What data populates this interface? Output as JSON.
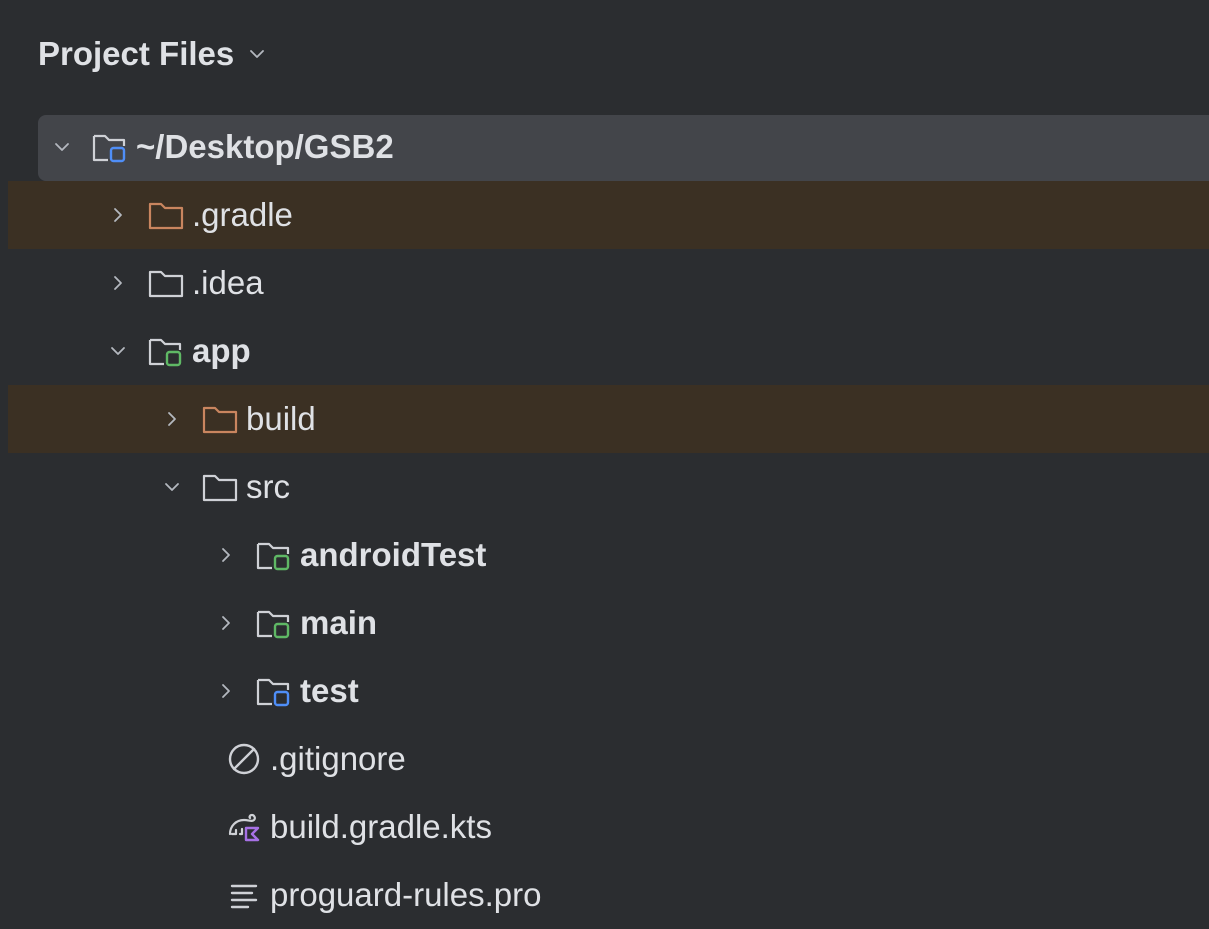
{
  "panel": {
    "title": "Project Files"
  },
  "tree": {
    "root": "~/Desktop/GSB2",
    "gradle": ".gradle",
    "idea": ".idea",
    "app": "app",
    "build": "build",
    "src": "src",
    "androidTest": "androidTest",
    "main": "main",
    "test": "test",
    "gitignore": ".gitignore",
    "build_gradle": "build.gradle.kts",
    "proguard": "proguard-rules.pro"
  },
  "colors": {
    "background": "#2b2d30",
    "excluded_row": "#3b3023",
    "selected_row": "#43454a",
    "folder_excluded": "#c9855f",
    "folder_plain": "#cfd1d6",
    "module_green": "#5fb865",
    "module_blue": "#4f8ef7",
    "kotlin_purple": "#a771e5"
  },
  "icons": {
    "header_dropdown": "chevron-down-icon",
    "expanded": "chevron-down-icon",
    "collapsed": "chevron-right-icon",
    "folder": "folder-icon",
    "module_folder": "module-folder-icon",
    "ignore_file": "ignore-file-icon",
    "gradle_kotlin": "gradle-kts-icon",
    "text_file": "text-file-icon"
  }
}
